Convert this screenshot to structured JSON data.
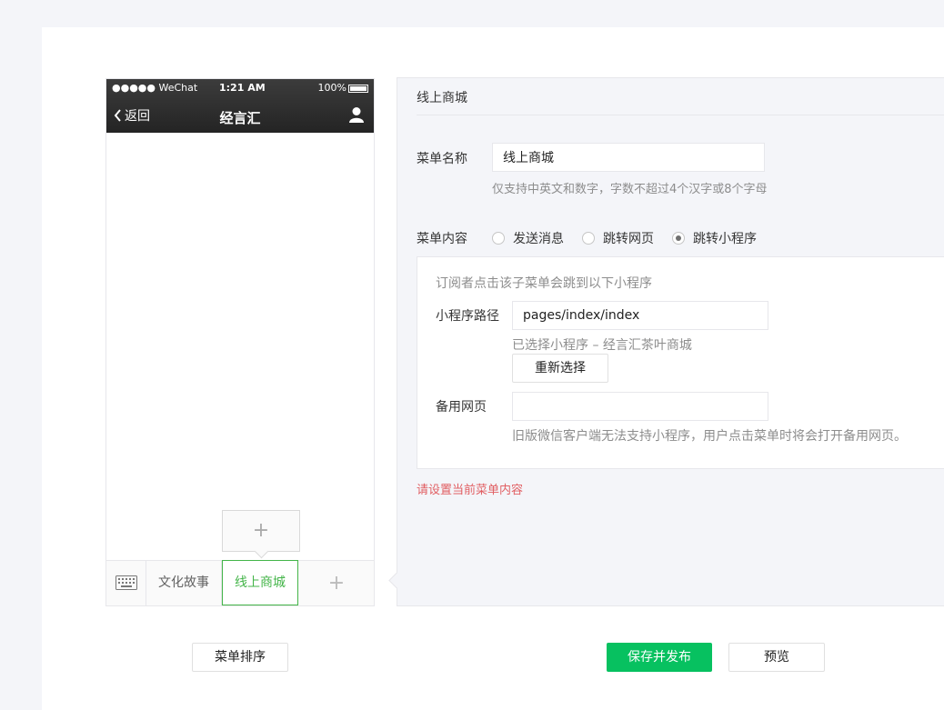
{
  "phone": {
    "status_signal": "●●●●● WeChat",
    "status_time": "1:21 AM",
    "status_battery": "100%",
    "back_label": "返回",
    "title": "经言汇",
    "menu_items": [
      "文化故事",
      "线上商城"
    ],
    "add_symbol": "+",
    "sub_add_symbol": "+"
  },
  "editor": {
    "title": "线上商城",
    "name_label": "菜单名称",
    "name_value": "线上商城",
    "name_hint": "仅支持中英文和数字，字数不超过4个汉字或8个字母",
    "content_label": "菜单内容",
    "radio_options": [
      {
        "label": "发送消息",
        "selected": false
      },
      {
        "label": "跳转网页",
        "selected": false
      },
      {
        "label": "跳转小程序",
        "selected": true
      }
    ],
    "box_tip": "订阅者点击该子菜单会跳到以下小程序",
    "path_label": "小程序路径",
    "path_value": "pages/index/index",
    "selected_info": "已选择小程序 – 经言汇茶叶商城",
    "reselect_button": "重新选择",
    "backup_label": "备用网页",
    "backup_value": "",
    "backup_hint": "旧版微信客户端无法支持小程序，用户点击菜单时将会打开备用网页。",
    "error_text": "请设置当前菜单内容"
  },
  "footer": {
    "sort_button": "菜单排序",
    "save_button": "保存并发布",
    "preview_button": "预览"
  },
  "colors": {
    "accent": "#07c160",
    "menu_active": "#44b549",
    "error": "#e15f63"
  }
}
